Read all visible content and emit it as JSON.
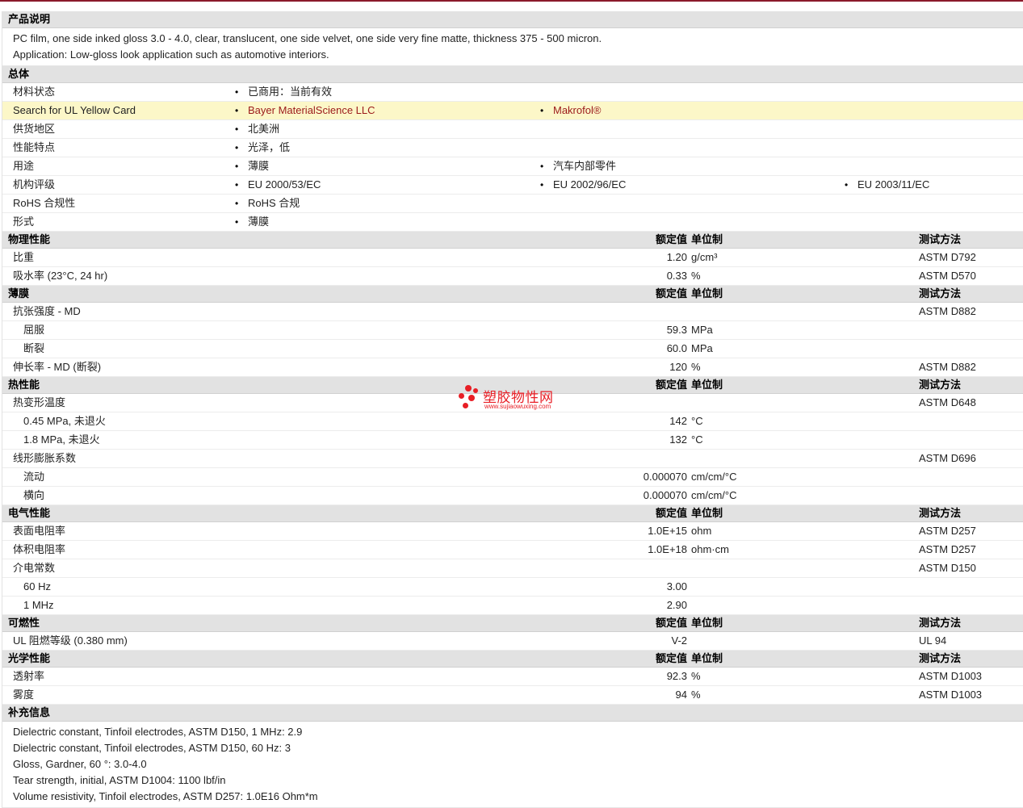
{
  "desc": {
    "title": "产品说明",
    "lines": [
      "PC film, one side inked gloss 3.0 - 4.0, clear, translucent, one side velvet, one side very fine matte, thickness 375 - 500 micron.",
      "Application: Low-gloss look application such as automotive interiors."
    ]
  },
  "general": {
    "title": "总体",
    "rows": [
      {
        "label": "材料状态",
        "v1": "已商用：当前有效"
      },
      {
        "label": "Search for UL Yellow Card",
        "v1": "Bayer MaterialScience LLC",
        "v2": "Makrofol®"
      },
      {
        "label": "供货地区",
        "v1": "北美洲"
      },
      {
        "label": "性能特点",
        "v1": "光泽，低"
      },
      {
        "label": "用途",
        "v1": "薄膜",
        "v2": "汽车内部零件"
      },
      {
        "label": "机构评级",
        "v1": "EU 2000/53/EC",
        "v2": "EU 2002/96/EC",
        "v3": "EU 2003/11/EC"
      },
      {
        "label": "RoHS 合规性",
        "v1": "RoHS 合规"
      },
      {
        "label": "形式",
        "v1": "薄膜"
      }
    ]
  },
  "cols": {
    "value": "额定值",
    "unit": "单位制",
    "test": "测试方法"
  },
  "physical": {
    "title": "物理性能",
    "rows": [
      {
        "label": "比重",
        "value": "1.20",
        "unit": "g/cm³",
        "test": "ASTM D792"
      },
      {
        "label": "吸水率  (23°C, 24 hr)",
        "value": "0.33",
        "unit": "%",
        "test": "ASTM D570"
      }
    ]
  },
  "film": {
    "title": "薄膜",
    "rows": [
      {
        "label": "抗张强度  - MD",
        "test": "ASTM D882"
      },
      {
        "label": "屈服",
        "value": "59.3",
        "unit": "MPa"
      },
      {
        "label": "断裂",
        "value": "60.0",
        "unit": "MPa"
      },
      {
        "label": "伸长率  - MD (断裂)",
        "value": "120",
        "unit": "%",
        "test": "ASTM D882"
      }
    ]
  },
  "thermal": {
    "title": "热性能",
    "rows": [
      {
        "label": "热变形温度",
        "test": "ASTM D648"
      },
      {
        "label": "0.45 MPa, 未退火",
        "value": "142",
        "unit": "°C"
      },
      {
        "label": "1.8 MPa, 未退火",
        "value": "132",
        "unit": "°C"
      },
      {
        "label": "线形膨胀系数",
        "test": "ASTM D696"
      },
      {
        "label": "流动",
        "value": "0.000070",
        "unit": "cm/cm/°C"
      },
      {
        "label": "横向",
        "value": "0.000070",
        "unit": "cm/cm/°C"
      }
    ]
  },
  "electrical": {
    "title": "电气性能",
    "rows": [
      {
        "label": "表面电阻率",
        "value": "1.0E+15",
        "unit": "ohm",
        "test": "ASTM D257"
      },
      {
        "label": "体积电阻率",
        "value": "1.0E+18",
        "unit": "ohm·cm",
        "test": "ASTM D257"
      },
      {
        "label": "介电常数",
        "test": "ASTM D150"
      },
      {
        "label": "60 Hz",
        "value": "3.00"
      },
      {
        "label": "1 MHz",
        "value": "2.90"
      }
    ]
  },
  "flammability": {
    "title": "可燃性",
    "rows": [
      {
        "label": "UL 阻燃等级  (0.380 mm)",
        "value": "V-2",
        "test": "UL 94"
      }
    ]
  },
  "optical": {
    "title": "光学性能",
    "rows": [
      {
        "label": "透射率",
        "value": "92.3",
        "unit": "%",
        "test": "ASTM D1003"
      },
      {
        "label": "雾度",
        "value": "94",
        "unit": "%",
        "test": "ASTM D1003"
      }
    ]
  },
  "supplement": {
    "title": "补充信息",
    "lines": [
      "Dielectric constant, Tinfoil electrodes, ASTM D150, 1 MHz: 2.9",
      "Dielectric constant, Tinfoil electrodes, ASTM D150, 60 Hz: 3",
      "Gloss, Gardner, 60 °: 3.0-4.0",
      "Tear strength, initial, ASTM D1004: 1100 lbf/in",
      "Volume resistivity, Tinfoil electrodes, ASTM D257: 1.0E16 Ohm*m"
    ]
  },
  "watermark": {
    "title": "塑胶物性网",
    "url": "www.sujiaowuxing.com"
  }
}
